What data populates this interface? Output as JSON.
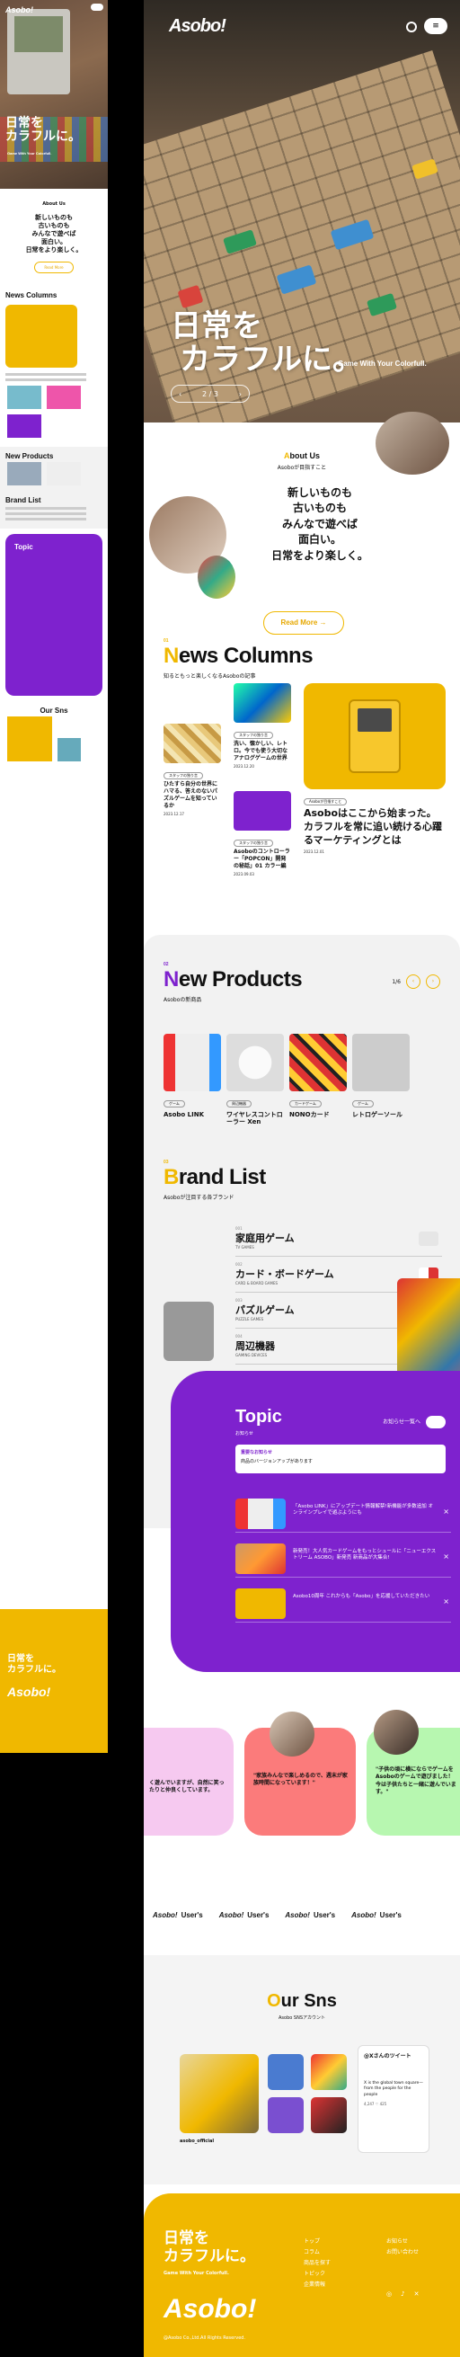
{
  "brand": {
    "logo": "Asobo!"
  },
  "mobile": {
    "catch_l1": "日常を",
    "catch_l2": "カラフルに。",
    "tagline": "Game With Your Colorfull.",
    "about_label": "About Us",
    "about_msg": "新しいものも\n古いものも\nみんなで遊べば\n面白い。\n日常をより楽しく。",
    "read_more": "Read More",
    "news_title": "News Columns",
    "products_title": "New Products",
    "brand_title": "Brand List",
    "topic_title": "Topic",
    "sns_title": "Our Sns",
    "footer_catch": "日常を\nカラフルに。"
  },
  "hero": {
    "catch_l1": "日常を",
    "catch_l2": "カラフルに。",
    "tagline": "Game With Your Colorfull.",
    "pager_prev": "‹",
    "pager_text": "2 / 3",
    "pager_next": "›",
    "menu_icon": "≡"
  },
  "about": {
    "label_prefix": "A",
    "label_rest": "bout Us",
    "label_jp": "Asoboが目指すこと",
    "msg_l1": "新しいものも",
    "msg_l2": "古いものも",
    "msg_l3": "みんなで遊べば",
    "msg_l4": "面白い。",
    "msg_l5": "日常をより楽しく。",
    "button": "Read More →"
  },
  "news": {
    "num": "01",
    "title_first": "N",
    "title_rest": "ews Columns",
    "sub": "知るともっと楽しくなるAsoboの記事",
    "cards": [
      {
        "tag": "スタッフの独り言",
        "text": "洗い、懐かしい、レトロ。今でも使う大切なアナログゲームの世界",
        "date": "2023.12.20"
      },
      {
        "tag": "スタッフの独り言",
        "text": "ひたすら自分の世界にハマる、答えのないパズルゲームを知っているか",
        "date": "2023.12.17"
      },
      {
        "tag": "スタッフの独り言",
        "text": "Asoboのコントローラー「POPCON」開発の秘話」01 カラー編",
        "date": "2023.09.03"
      },
      {
        "tag": "Asoboが目指すこと",
        "text": "Asoboはここから始まった。カラフルを常に追い続ける心躍るマーケティングとは",
        "date": "2023.12.01"
      }
    ]
  },
  "products": {
    "num": "02",
    "title_first": "N",
    "title_rest": "ew Products",
    "sub": "Asoboの新商品",
    "pager": "1/6",
    "prev": "‹",
    "next": "›",
    "items": [
      {
        "cat": "ゲーム",
        "name": "Asobo LINK"
      },
      {
        "cat": "周辺機器",
        "name": "ワイヤレスコントローラー Xen"
      },
      {
        "cat": "カードゲーム",
        "name": "NONOカード"
      },
      {
        "cat": "ゲーム",
        "name": "レトロゲーソール"
      }
    ]
  },
  "brand_list": {
    "num": "03",
    "title_first": "B",
    "title_rest": "rand List",
    "sub": "Asoboが注目する各ブランド",
    "rows": [
      {
        "no": "001",
        "jp": "家庭用ゲーム",
        "en": "TV GAMES"
      },
      {
        "no": "002",
        "jp": "カード・ボードゲーム",
        "en": "CARD & BOARD GAMES"
      },
      {
        "no": "003",
        "jp": "パズルゲーム",
        "en": "PUZZLE GAMES"
      },
      {
        "no": "004",
        "jp": "周辺機器",
        "en": "GAMING DEVICES"
      }
    ]
  },
  "topic": {
    "title": "Topic",
    "sub": "お知らせ",
    "more": "お知らせ一覧へ",
    "notice_a": "重要なお知らせ",
    "notice_b": "商品のバージョンアップがあります",
    "items": [
      {
        "text": "「Asobo LINK」にアップデート情報解禁!新機能が多数追加 オンラインプレイで遊ぶようにも",
        "close": "×"
      },
      {
        "text": "新発売！大人気カードゲームをもっとシュールに「ニューエクストリーム ASOBO」新発売 新商品が大集合!",
        "close": "×"
      },
      {
        "text": "Asobo10周年 これからも「Asobo」を応援していただきたい",
        "close": "×"
      }
    ]
  },
  "voices": {
    "v1": "く遊んでいますが、自然に笑ったりと仲良くしています。",
    "v2": "\"家族みんなで楽しめるので、週末が家族時間になっています！\"",
    "v3": "\"子供の頃に横にならでゲームをAsoboのゲームで遊びました！今は子供たちと一緒に遊んでいます。\""
  },
  "marquee": {
    "logo": "Asobo!",
    "label": "User's"
  },
  "sns": {
    "num": "04",
    "title_first": "O",
    "title_rest": "ur Sns",
    "sub": "Asobo SNSアカウント",
    "account": "asobo_official",
    "x_header": "@Xさんのツイート",
    "x_text": "X is the global town square—from the people for the people",
    "x_stats": "4,247  ♡ 425"
  },
  "footer": {
    "catch_l1": "日常を",
    "catch_l2": "カラフルに。",
    "tagline": "Game With Your Colorfull.",
    "logo": "Asobo!",
    "copy": "@Asobo Co.,Ltd.All Rights Reserved.",
    "nav1": [
      "トップ",
      "コラム",
      "商品を探す",
      "トピック",
      "企業情報"
    ],
    "nav2": [
      "お知らせ",
      "お問い合わせ"
    ],
    "social": [
      "◎",
      "♪",
      "✕"
    ]
  },
  "colors": {
    "accent": "#f0b800",
    "purple": "#7e22ce"
  }
}
